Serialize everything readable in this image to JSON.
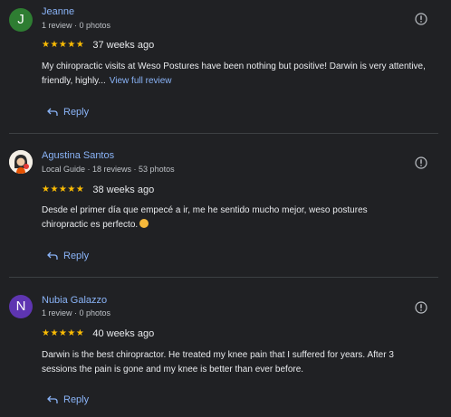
{
  "reviews": [
    {
      "name": "Jeanne",
      "initial": "J",
      "avatar_color": "#2e7d32",
      "meta": "1 review · 0 photos",
      "stars": "★★★★★",
      "date": "37 weeks ago",
      "text": "My chiropractic visits at Weso Postures have been nothing but positive! Darwin is very attentive, friendly, highly...",
      "more_link": "View full review",
      "reply_label": "Reply"
    },
    {
      "name": "Agustina Santos",
      "initial": "",
      "avatar_color": "#f4efe6",
      "meta": "Local Guide · 18 reviews · 53 photos",
      "stars": "★★★★★",
      "date": "38 weeks ago",
      "text": "Desde el primer día que empecé a ir, me he sentido mucho mejor, weso postures chiropractic es perfecto.",
      "reply_label": "Reply"
    },
    {
      "name": "Nubia Galazzo",
      "initial": "N",
      "avatar_color": "#5e35b1",
      "meta": "1 review · 0 photos",
      "stars": "★★★★★",
      "date": "40 weeks ago",
      "text": "Darwin is the best chiropractor. He treated my knee pain that I suffered for years. After 3 sessions the pain is gone and my knee is better than ever before.",
      "reply_label": "Reply"
    }
  ],
  "colors": {
    "background": "#202124",
    "link": "#8ab4f8",
    "star": "#fbbc04",
    "divider": "#3c4043"
  },
  "icons": {
    "info": "info-icon",
    "reply": "reply-arrow-icon",
    "emoji": "smiling-face-emoji"
  }
}
